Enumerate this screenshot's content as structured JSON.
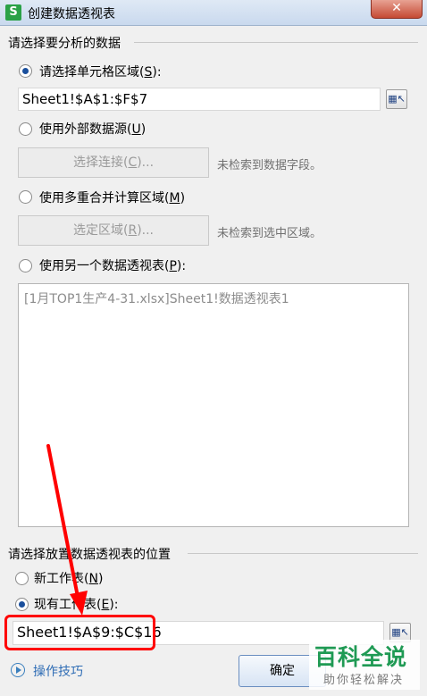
{
  "window": {
    "title": "创建数据透视表",
    "app_icon": "S",
    "close_glyph": "✕"
  },
  "source_group": {
    "label": "请选择要分析的数据",
    "options": [
      {
        "prefix": "请选择单元格区域(",
        "key": "S",
        "suffix": "):",
        "selected": true
      },
      {
        "prefix": "使用外部数据源(",
        "key": "U",
        "suffix": ")",
        "selected": false
      },
      {
        "prefix": "使用多重合并计算区域(",
        "key": "M",
        "suffix": ")",
        "selected": false
      },
      {
        "prefix": "使用另一个数据透视表(",
        "key": "P",
        "suffix": "):",
        "selected": false
      }
    ],
    "range_value": "Sheet1!$A$1:$F$7",
    "connect_button": {
      "prefix": "选择连接(",
      "key": "C",
      "suffix": ")..."
    },
    "connect_hint": "未检索到数据字段。",
    "region_button": {
      "prefix": "选定区域(",
      "key": "R",
      "suffix": ")..."
    },
    "region_hint": "未检索到选中区域。",
    "pivot_list": [
      "[1月TOP1生产4-31.xlsx]Sheet1!数据透视表1"
    ]
  },
  "dest_group": {
    "label": "请选择放置数据透视表的位置",
    "options": [
      {
        "prefix": "新工作表(",
        "key": "N",
        "suffix": ")",
        "selected": false
      },
      {
        "prefix": "现有工作表(",
        "key": "E",
        "suffix": "):",
        "selected": true
      }
    ],
    "range_value": "Sheet1!$A$9:$C$16"
  },
  "footer": {
    "tips_label": "操作技巧",
    "ok_label": "确定"
  },
  "watermark": {
    "title": "百科全说",
    "subtitle": "助你轻松解决"
  },
  "colors": {
    "accent": "#1a4f9c",
    "highlight": "#ff0000",
    "watermark": "#1f9a54"
  },
  "icons": {
    "picker": "range-picker-icon"
  }
}
